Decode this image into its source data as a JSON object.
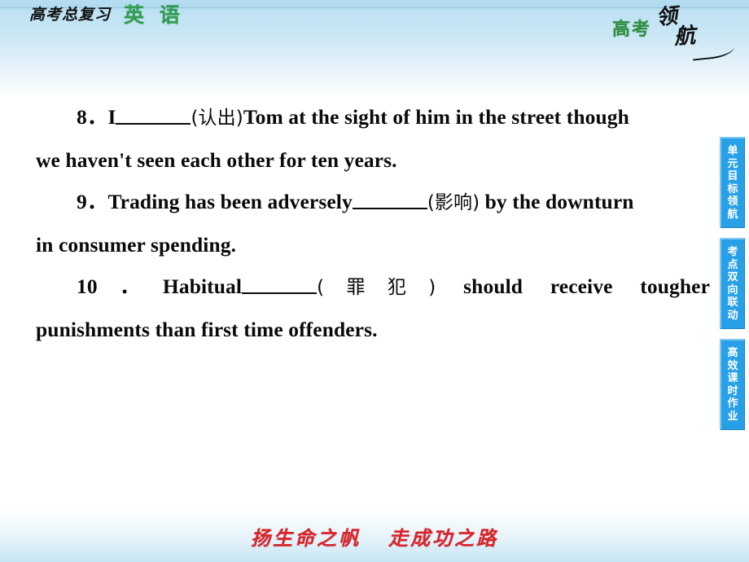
{
  "header": {
    "brand_cn": "高考总复习",
    "subject": "英 语",
    "logo_main": "高考",
    "logo_ling": "领",
    "logo_hang": "航",
    "brand_green": "#2f9e4f",
    "band_top_color": "#b5dcf0"
  },
  "main": {
    "questions": [
      {
        "number": "8．",
        "seg1": "I",
        "blank": "________",
        "cn": "(认出)",
        "seg2": "Tom at the sight of him in the street though",
        "line2": "we haven't seen each other for ten years."
      },
      {
        "number": "9．",
        "seg1": "Trading has been adversely",
        "blank": "________",
        "cn": "(影响)",
        "seg2": " by the downturn",
        "line2": "in consumer spending."
      },
      {
        "number": "10．",
        "seg1": "Habitual",
        "blank": "________",
        "cn": "(罪犯)",
        "seg2": " should receive tougher",
        "line2": "punishments than first time offenders."
      }
    ]
  },
  "tabs": {
    "color": "#28a0e8",
    "items": [
      {
        "label": "单元目标领航"
      },
      {
        "label": "考点双向联动"
      },
      {
        "label": "高效课时作业"
      }
    ]
  },
  "footer": {
    "left_text": "扬生命之帆",
    "right_text": "走成功之路",
    "color": "#d8242a"
  }
}
